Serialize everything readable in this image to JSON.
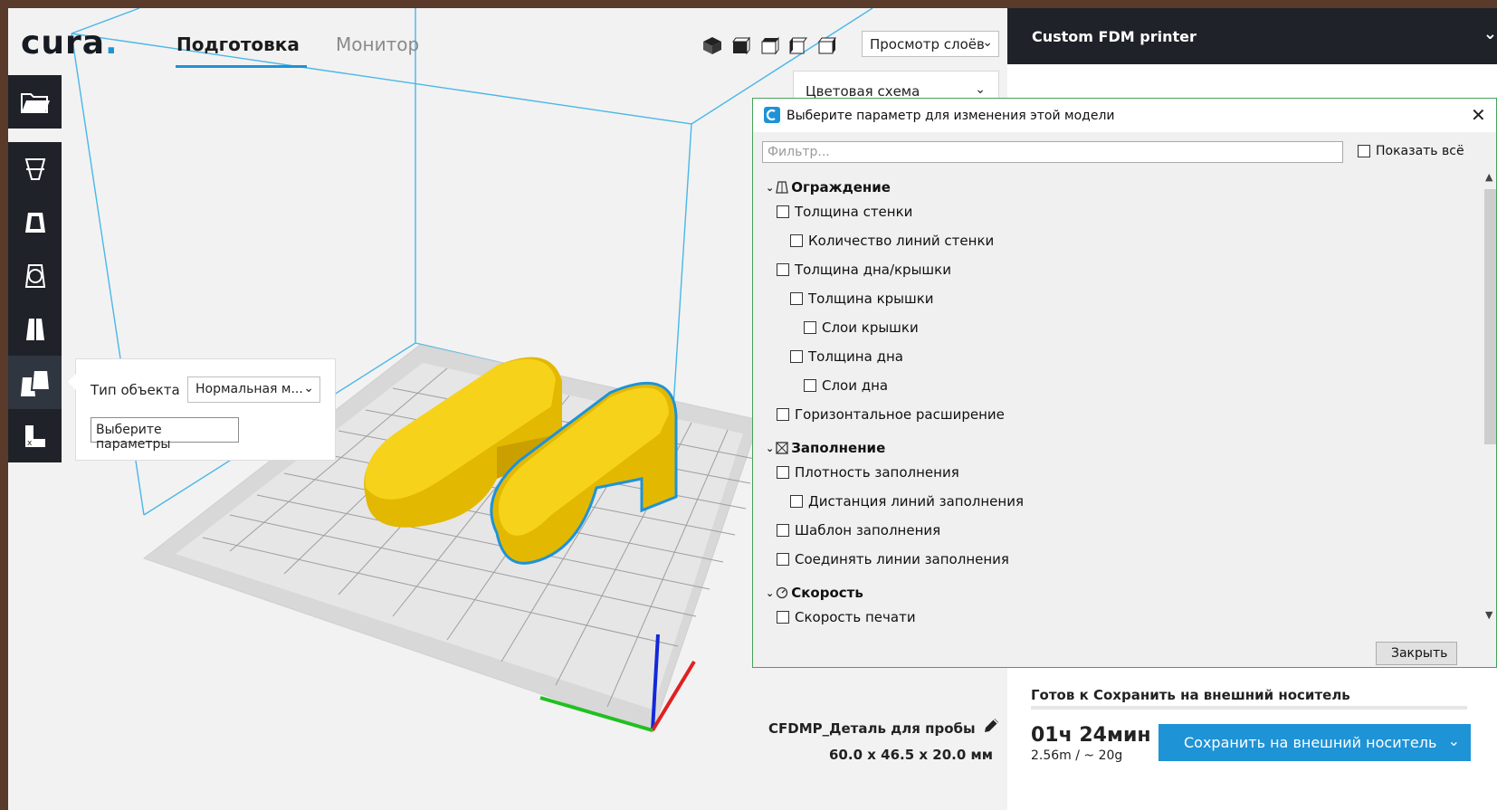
{
  "app": {
    "logo_text": "cura",
    "logo_dot": ".",
    "tabs": [
      {
        "label": "Подготовка",
        "active": true
      },
      {
        "label": "Монитор",
        "active": false
      }
    ],
    "view_icons": [
      "view-3d-icon",
      "view-front-icon",
      "view-top-icon",
      "view-left-icon",
      "view-right-icon"
    ],
    "view_mode": "Просмотр слоёв",
    "color_scheme": "Цветовая схема",
    "accent": "#1e93d6"
  },
  "printer": {
    "name": "Custom FDM printer"
  },
  "toolbar": {
    "items": [
      "open-file-icon",
      "move-tool-icon",
      "scale-tool-icon",
      "rotate-tool-icon",
      "mirror-tool-icon",
      "per-model-settings-icon",
      "support-blocker-icon"
    ]
  },
  "model_popup": {
    "object_type_label": "Тип объекта",
    "object_type_value": "Нормальная м...",
    "select_settings_button": "Выберите параметры"
  },
  "dialog": {
    "title": "Выберите параметр для изменения этой модели",
    "close_icon": "close-icon",
    "filter_placeholder": "Фильтр...",
    "show_all_label": "Показать всё",
    "close_button": "Закрыть",
    "sections": [
      {
        "label": "Ограждение",
        "icon": "shell-icon",
        "items": [
          {
            "label": "Толщина стенки",
            "level": 0
          },
          {
            "label": "Количество линий стенки",
            "level": 1
          },
          {
            "label": "Толщина дна/крышки",
            "level": 0
          },
          {
            "label": "Толщина крышки",
            "level": 1
          },
          {
            "label": "Слои крышки",
            "level": 2
          },
          {
            "label": "Толщина дна",
            "level": 1
          },
          {
            "label": "Слои дна",
            "level": 2
          },
          {
            "label": "Горизонтальное расширение",
            "level": 0
          }
        ]
      },
      {
        "label": "Заполнение",
        "icon": "infill-icon",
        "items": [
          {
            "label": "Плотность заполнения",
            "level": 0
          },
          {
            "label": "Дистанция линий заполнения",
            "level": 1
          },
          {
            "label": "Шаблон заполнения",
            "level": 0
          },
          {
            "label": "Соединять линии заполнения",
            "level": 0
          }
        ]
      },
      {
        "label": "Скорость",
        "icon": "speed-icon",
        "items": [
          {
            "label": "Скорость печати",
            "level": 0
          }
        ]
      }
    ]
  },
  "job": {
    "name": "CFDMP_Деталь для пробы",
    "dimensions": "60.0 x 46.5 x 20.0 мм"
  },
  "output": {
    "status": "Готов к Сохранить на внешний носитель",
    "time": "01ч 24мин",
    "material": "2.56m / ~ 20g",
    "save_button": "Сохранить на внешний носитель"
  }
}
